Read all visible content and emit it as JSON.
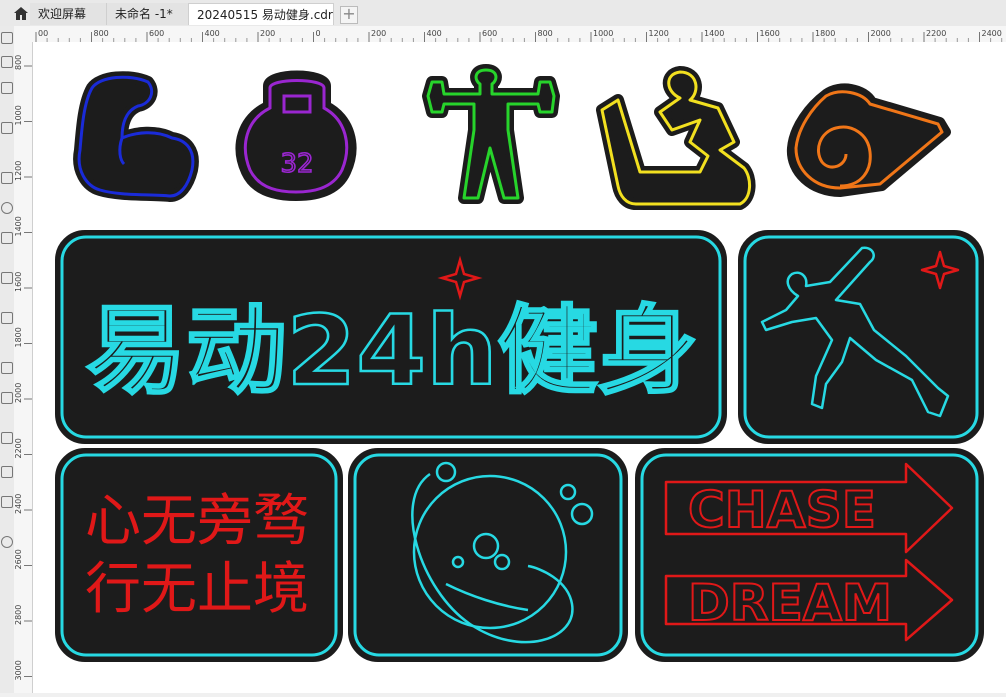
{
  "tabs": [
    {
      "label": "欢迎屏幕"
    },
    {
      "label": "未命名 -1*"
    },
    {
      "label": "20240515 易动健身.cdr"
    }
  ],
  "add_tab_label": "+",
  "ruler": {
    "top_ticks": [
      "00",
      "800",
      "600",
      "400",
      "200",
      "0",
      "200",
      "400",
      "600",
      "800",
      "1000",
      "1200",
      "1400",
      "1600",
      "1800",
      "2000",
      "2200",
      "2400"
    ],
    "left_ticks": [
      "800",
      "1000",
      "1200",
      "1400",
      "1600",
      "1800",
      "2000",
      "2200",
      "2400",
      "2600",
      "2800",
      "3000"
    ]
  },
  "artwork": {
    "kettlebell_number": "32",
    "brand_title": "易动24h健身",
    "slogan_line1": "心无旁骛",
    "slogan_line2": "行无止境",
    "arrow_word_1": "CHASE",
    "arrow_word_2": "DREAM"
  },
  "colors": {
    "panel_fill": "#1c1c1c",
    "cyan": "#27d9e3",
    "red": "#e01818",
    "blue": "#1a2bd8",
    "purple": "#9a26d0",
    "green": "#27d42b",
    "yellow": "#f2e020",
    "orange": "#f07618"
  },
  "icons": [
    "flexed-arm-icon",
    "kettlebell-icon",
    "weightlifter-icon",
    "treadmill-runner-icon",
    "yoga-mat-icon",
    "sprinter-icon",
    "planet-icon"
  ]
}
